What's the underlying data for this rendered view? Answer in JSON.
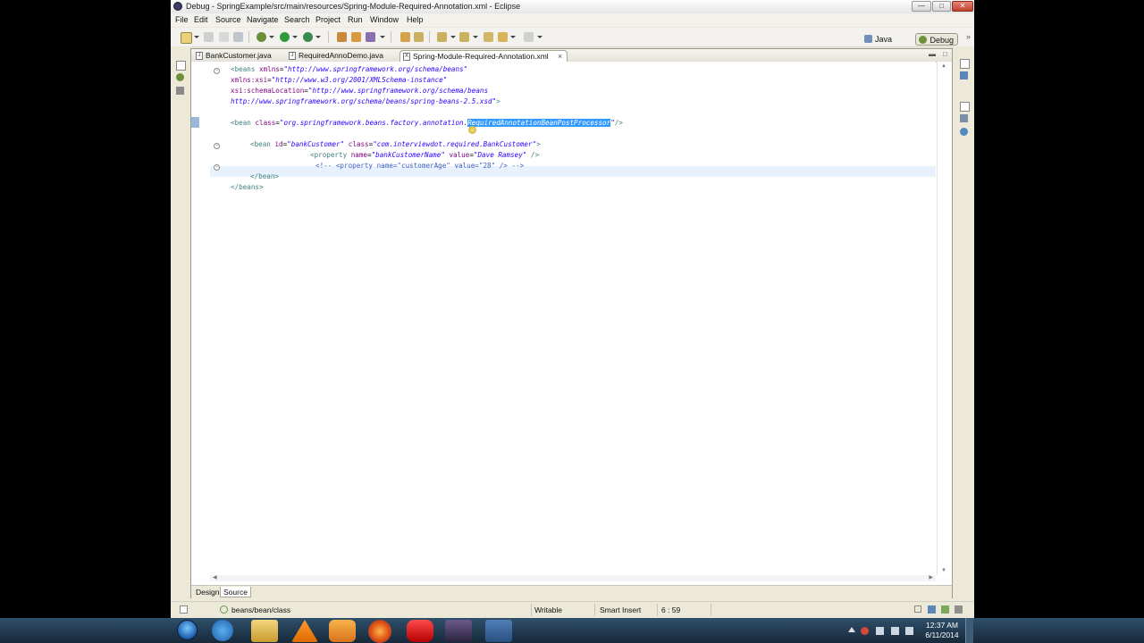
{
  "window": {
    "title": "Debug - SpringExample/src/main/resources/Spring-Module-Required-Annotation.xml - Eclipse"
  },
  "menubar": [
    "File",
    "Edit",
    "Source",
    "Navigate",
    "Search",
    "Project",
    "Run",
    "Window",
    "Help"
  ],
  "perspectives": [
    {
      "label": "Java",
      "active": false
    },
    {
      "label": "Debug",
      "active": true
    }
  ],
  "editor_tabs": [
    {
      "label": "BankCustomer.java",
      "active": false,
      "icon": "java-file-icon"
    },
    {
      "label": "RequiredAnnoDemo.java",
      "active": false,
      "icon": "java-file-icon"
    },
    {
      "label": "Spring-Module-Required-Annotation.xml",
      "active": true,
      "icon": "xml-file-icon"
    }
  ],
  "code": {
    "l1": {
      "open": "<beans ",
      "attr": "xmlns",
      "eq": "=",
      "val": "\"http://www.springframework.org/schema/beans\""
    },
    "l2": {
      "attr": "xmlns:xsi",
      "eq": "=",
      "val": "\"http://www.w3.org/2001/XMLSchema-instance\""
    },
    "l3": {
      "attr": "xsi:schemaLocation",
      "eq": "=",
      "val": "\"http://www.springframework.org/schema/beans"
    },
    "l4": {
      "val": "http://www.springframework.org/schema/beans/spring-beans-2.5.xsd\"",
      "close": ">"
    },
    "l6": {
      "open": "<bean ",
      "attr": "class",
      "eq": "=",
      "val": "\"org.springframework.beans.factory.annotation.",
      "selected": "RequiredAnnotationBeanPostProcessor",
      "val_end": "\"",
      "close": "/>"
    },
    "l8": {
      "open": "<bean ",
      "attr1": "id",
      "val1": "\"bankCustomer\"",
      "attr2": "class",
      "val2": "\"com.interviewdot.required.BankCustomer\"",
      "close": ">"
    },
    "l9": {
      "open": "<property ",
      "attr1": "name",
      "val1": "\"bankCustomerName\"",
      "attr2": "value",
      "val2": "\"Dave Ramsey\"",
      "close": " />"
    },
    "l10": {
      "comment": "<!-- <property name=\"customerAge\" value=\"28\" /> -->"
    },
    "l11": {
      "close": "</bean>"
    },
    "l12": {
      "close": "</beans>"
    }
  },
  "bottom_tabs": [
    {
      "label": "Design",
      "active": false
    },
    {
      "label": "Source",
      "active": true
    }
  ],
  "status": {
    "path": "beans/bean/class",
    "writable": "Writable",
    "insert_mode": "Smart Insert",
    "position": "6 : 59"
  },
  "clock": {
    "time": "12:37 AM",
    "date": "6/11/2014"
  },
  "colors": {
    "tag": "#3f7f7f",
    "attribute": "#7f007f",
    "string": "#2a00ff",
    "comment": "#3f5fbf",
    "selection": "#3399ff",
    "current_line": "#e8f2fe"
  }
}
